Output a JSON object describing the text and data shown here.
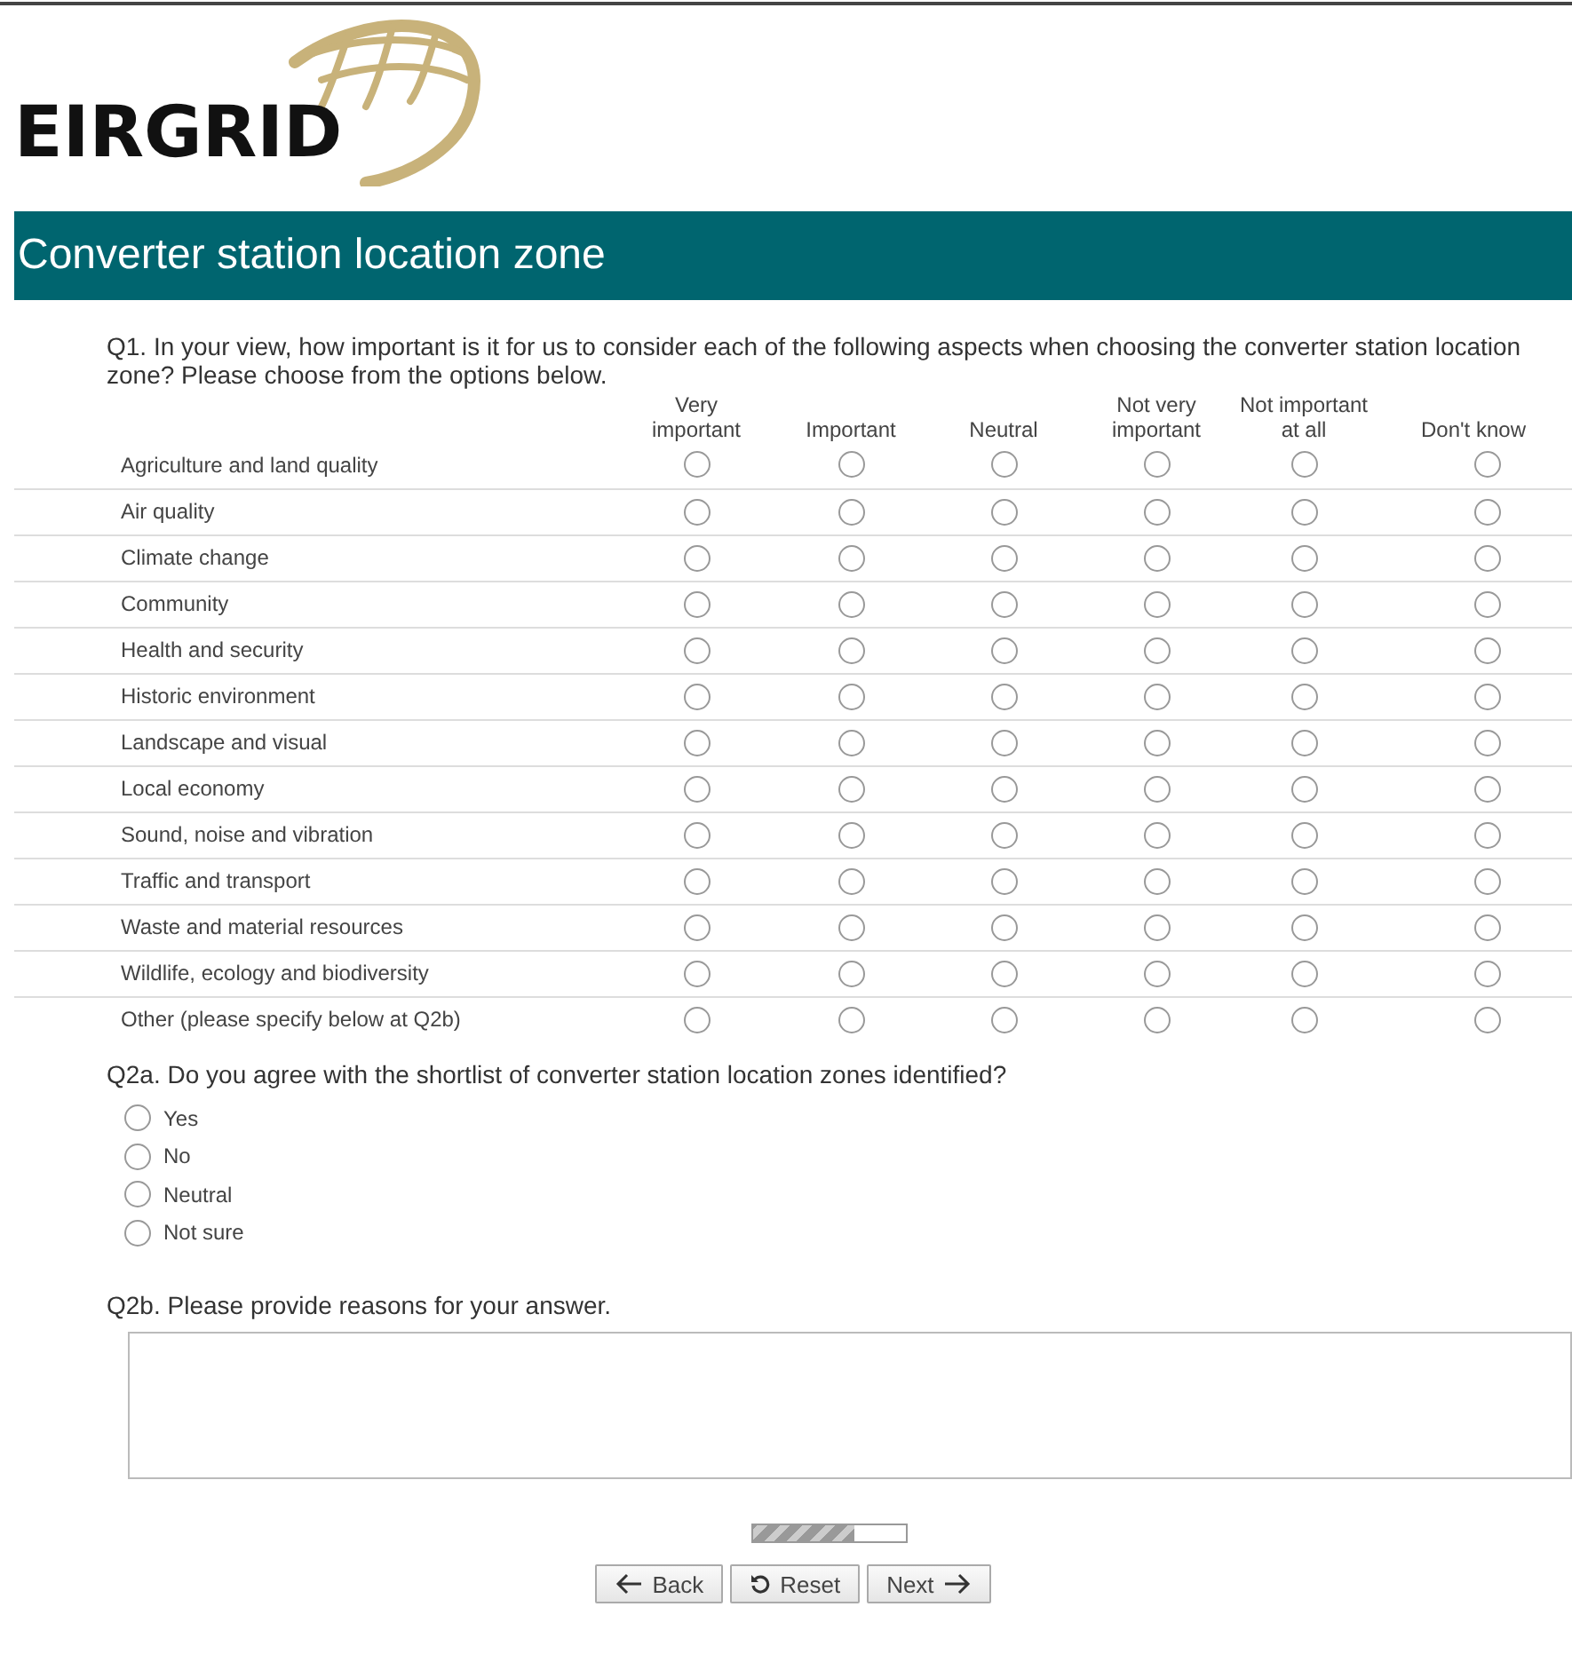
{
  "logo": {
    "text": "EIRGRID"
  },
  "header": {
    "title": "Converter station location zone"
  },
  "q1": {
    "question": "Q1. In your view, how important is it for us to consider each of the following aspects when choosing the converter station location zone? Please choose from the options below.",
    "columns": [
      "Very important",
      "Important",
      "Neutral",
      "Not very important",
      "Not important at all",
      "Don't know"
    ],
    "rows": [
      {
        "label": "Agriculture and land quality",
        "selected": [
          false,
          false,
          false,
          false,
          false,
          false
        ]
      },
      {
        "label": "Air quality",
        "selected": [
          false,
          false,
          false,
          false,
          false,
          false
        ]
      },
      {
        "label": "Climate change",
        "selected": [
          false,
          false,
          false,
          false,
          false,
          false
        ]
      },
      {
        "label": "Community",
        "selected": [
          false,
          false,
          false,
          false,
          false,
          false
        ]
      },
      {
        "label": "Health and security",
        "selected": [
          false,
          false,
          false,
          false,
          false,
          false
        ]
      },
      {
        "label": "Historic environment",
        "selected": [
          false,
          false,
          false,
          false,
          false,
          false
        ]
      },
      {
        "label": "Landscape and visual",
        "selected": [
          false,
          false,
          false,
          false,
          false,
          false
        ]
      },
      {
        "label": "Local economy",
        "selected": [
          false,
          false,
          false,
          false,
          false,
          false
        ]
      },
      {
        "label": "Sound, noise and vibration",
        "selected": [
          false,
          false,
          false,
          false,
          false,
          false
        ]
      },
      {
        "label": "Traffic and transport",
        "selected": [
          false,
          false,
          false,
          false,
          false,
          false
        ]
      },
      {
        "label": "Waste and material resources",
        "selected": [
          false,
          false,
          false,
          false,
          false,
          false
        ]
      },
      {
        "label": "Wildlife, ecology and biodiversity",
        "selected": [
          false,
          false,
          false,
          false,
          false,
          false
        ]
      },
      {
        "label": "Other (please specify below at Q2b)",
        "selected": [
          false,
          false,
          false,
          false,
          false,
          false
        ]
      }
    ]
  },
  "q2a": {
    "question": "Q2a. Do you agree with the shortlist of converter station location zones identified?",
    "options": [
      {
        "label": "Yes",
        "selected": false
      },
      {
        "label": "No",
        "selected": false
      },
      {
        "label": "Neutral",
        "selected": false
      },
      {
        "label": "Not sure",
        "selected": false
      }
    ]
  },
  "q2b": {
    "question": "Q2b. Please provide reasons for your answer."
  },
  "progress": {
    "level": 0.67
  },
  "buttons": [
    {
      "kind": "back",
      "label": "Back"
    },
    {
      "kind": "reset",
      "label": "Reset"
    },
    {
      "kind": "next",
      "label": "Next"
    }
  ]
}
